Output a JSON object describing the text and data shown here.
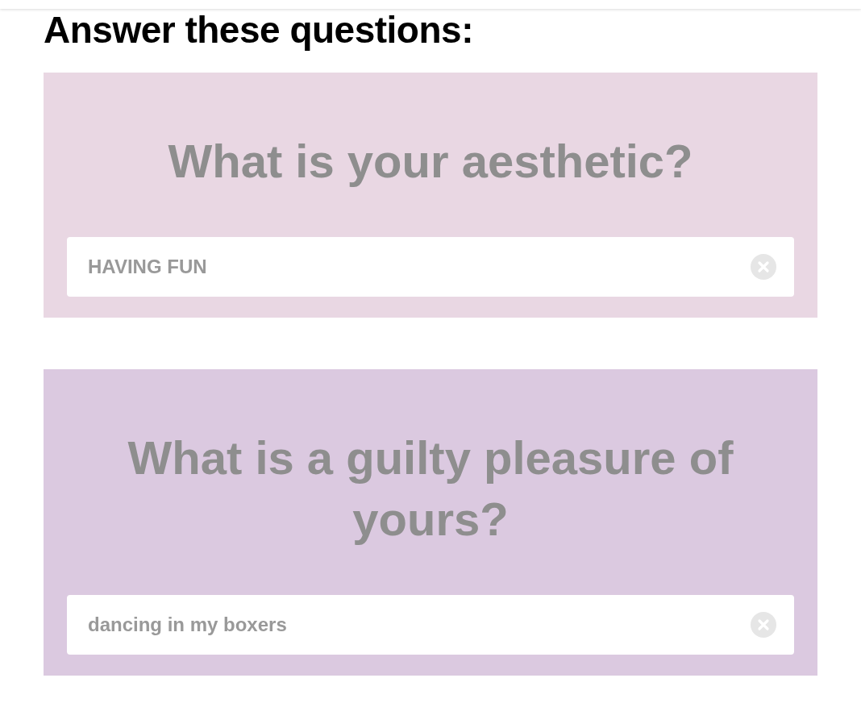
{
  "heading": "Answer these questions:",
  "questions": [
    {
      "question": "What is your aesthetic?",
      "answer": "HAVING FUN",
      "color": "#e9d7e3"
    },
    {
      "question": "What is a guilty pleasure of yours?",
      "answer": "dancing in my boxers",
      "color": "#dbc9e0"
    }
  ]
}
